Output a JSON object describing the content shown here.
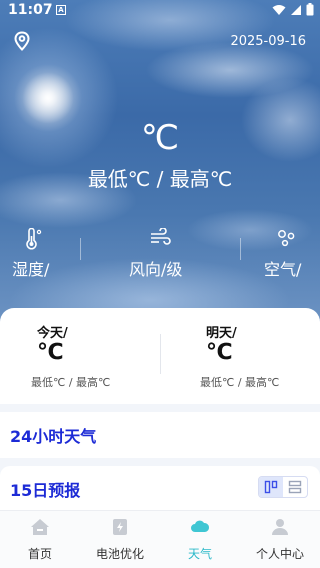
{
  "status_bar": {
    "time": "11:07",
    "badge": "A"
  },
  "header": {
    "date": "2025-09-16"
  },
  "current": {
    "temperature": "℃",
    "range": "最低℃  /  最高℃"
  },
  "metrics": [
    {
      "icon": "thermometer-icon",
      "label": "湿度/"
    },
    {
      "icon": "wind-icon",
      "label": "风向/级"
    },
    {
      "icon": "air-quality-icon",
      "label": "空气/"
    }
  ],
  "days": [
    {
      "name": "今天/",
      "temp": "℃",
      "range": "最低℃ / 最高℃"
    },
    {
      "name": "明天/",
      "temp": "℃",
      "range": "最低℃ / 最高℃"
    }
  ],
  "sections": {
    "hourly_title": "24小时天气",
    "forecast_title": "15日预报"
  },
  "tabs": [
    {
      "label": "首页",
      "icon": "home-icon",
      "active": false
    },
    {
      "label": "电池优化",
      "icon": "battery-icon",
      "active": false
    },
    {
      "label": "天气",
      "icon": "cloud-icon",
      "active": true
    },
    {
      "label": "个人中心",
      "icon": "person-icon",
      "active": false
    }
  ],
  "colors": {
    "accent": "#1d2bd6",
    "tab_active": "#2bb9c9"
  }
}
